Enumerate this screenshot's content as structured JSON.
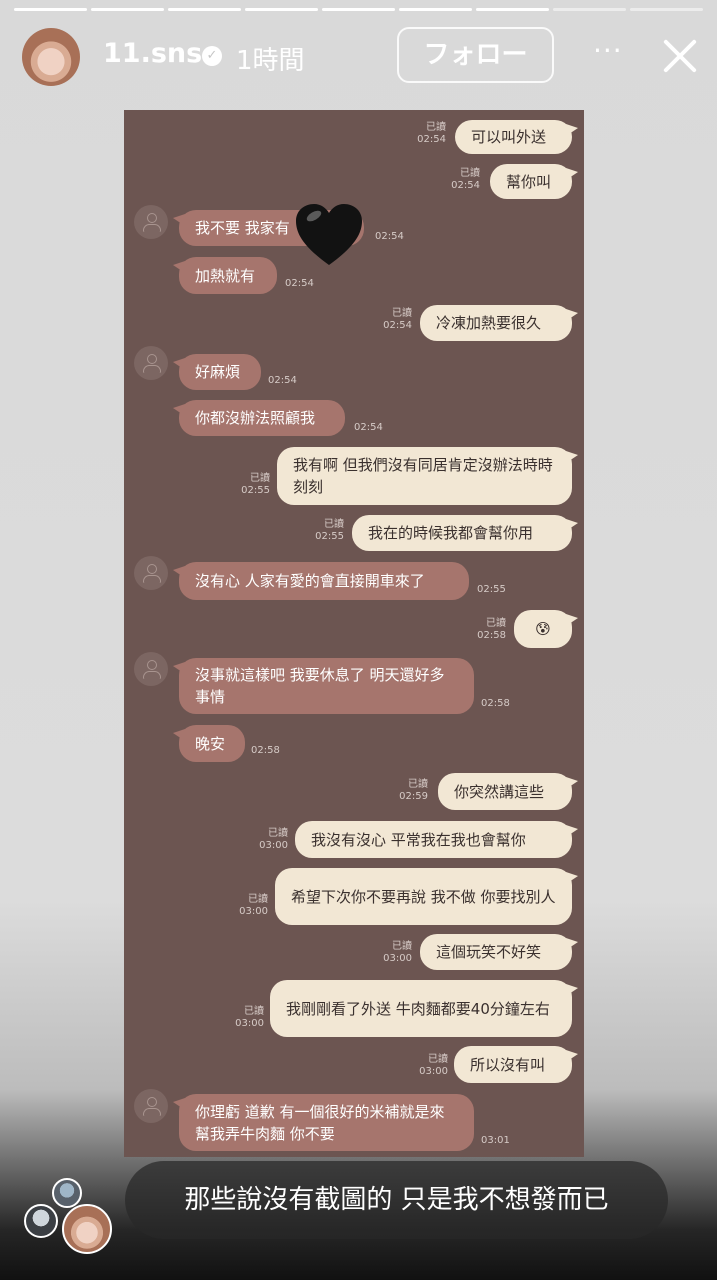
{
  "story": {
    "segments_total": 9,
    "segments_done": 7
  },
  "header": {
    "username": "11.sns",
    "verified_icon": "verified-badge-icon",
    "time": "1時間",
    "follow_label": "フォロー",
    "more_label": "···",
    "close_icon": "close-icon"
  },
  "chat": {
    "read_label": "已讀",
    "messages": [
      {
        "side": "me",
        "text": "可以叫外送",
        "time": "02:54"
      },
      {
        "side": "me",
        "text": "幫你叫",
        "time": "02:54"
      },
      {
        "side": "other",
        "text": "我不要 我家有",
        "time": "02:54"
      },
      {
        "side": "other",
        "text": "加熱就有",
        "time": "02:54"
      },
      {
        "side": "me",
        "text": "冷凍加熱要很久",
        "time": "02:54"
      },
      {
        "side": "other",
        "text": "好麻煩",
        "time": "02:54"
      },
      {
        "side": "other",
        "text": "你都沒辦法照顧我",
        "time": "02:54"
      },
      {
        "side": "me",
        "text": "我有啊 但我們沒有同居肯定沒辦法時時刻刻",
        "time": "02:55"
      },
      {
        "side": "me",
        "text": "我在的時候我都會幫你用",
        "time": "02:55"
      },
      {
        "side": "other",
        "text": "沒有心 人家有愛的會直接開車來了",
        "time": "02:55"
      },
      {
        "side": "me",
        "text": "😰",
        "time": "02:58"
      },
      {
        "side": "other",
        "text": "沒事就這樣吧 我要休息了 明天還好多事情",
        "time": "02:58"
      },
      {
        "side": "other",
        "text": "晚安",
        "time": "02:58"
      },
      {
        "side": "me",
        "text": "你突然講這些",
        "time": "02:59"
      },
      {
        "side": "me",
        "text": "我沒有沒心 平常我在我也會幫你",
        "time": "03:00"
      },
      {
        "side": "me",
        "text": "希望下次你不要再說 我不做 你要找別人",
        "time": "03:00"
      },
      {
        "side": "me",
        "text": "這個玩笑不好笑",
        "time": "03:00"
      },
      {
        "side": "me",
        "text": "我剛剛看了外送 牛肉麵都要40分鐘左右",
        "time": "03:00"
      },
      {
        "side": "me",
        "text": "所以沒有叫",
        "time": "03:00"
      },
      {
        "side": "other",
        "text": "你理虧 道歉 有一個很好的米補就是來幫我弄牛肉麵 你不要",
        "time": "03:01"
      }
    ],
    "sticker_icon": "black-heart-icon"
  },
  "caption": {
    "text": "那些說沒有截圖的 只是我不想發而已"
  },
  "colors": {
    "chat_bg": "#6c5551",
    "my_bubble": "#f2e7d4",
    "their_bubble": "#a6756d"
  }
}
